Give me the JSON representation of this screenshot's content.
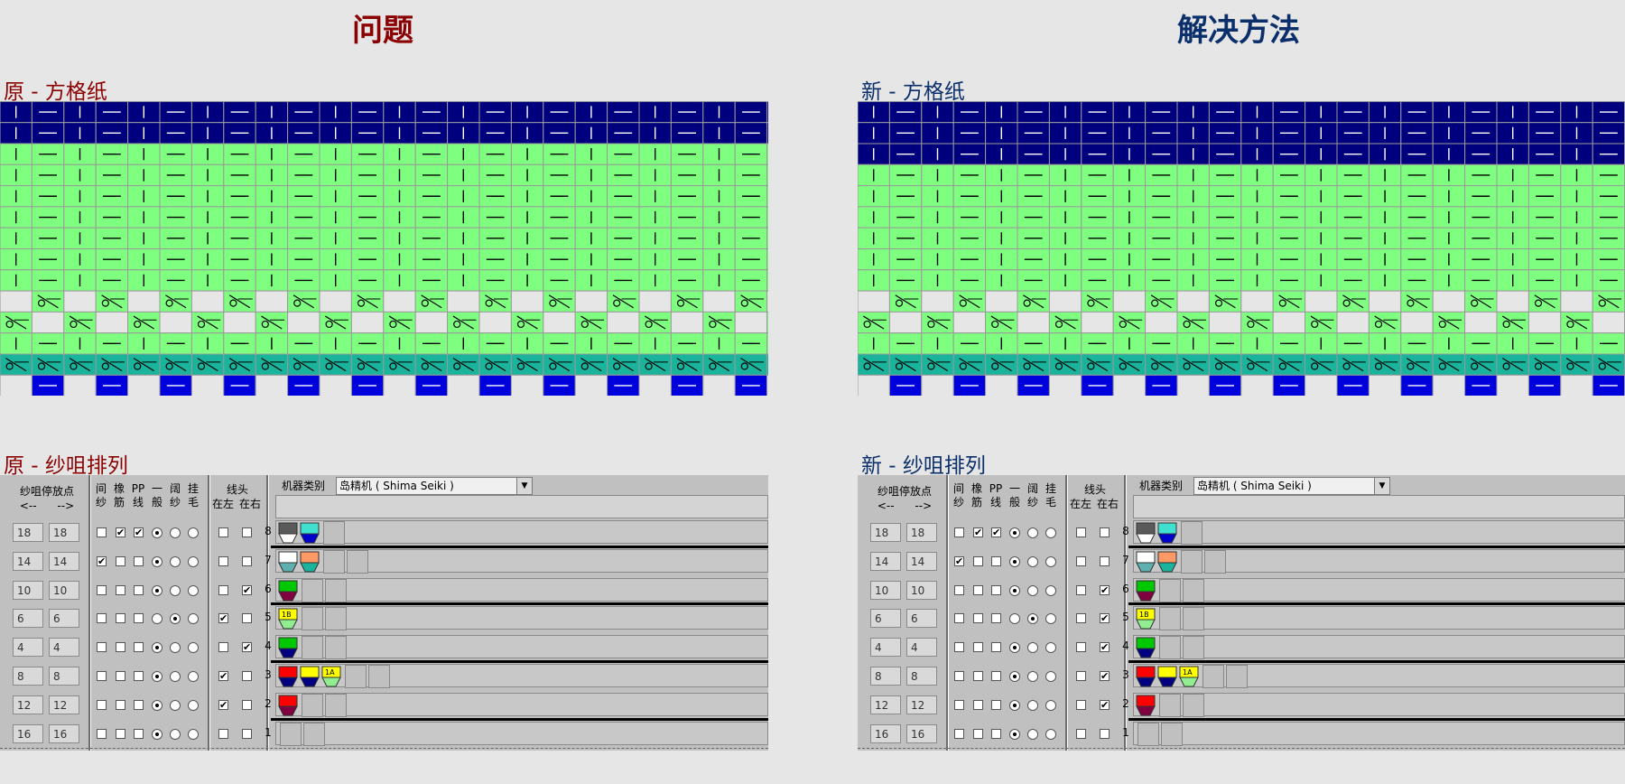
{
  "problem": {
    "heading": "问题",
    "grid_title": "原 - 方格纸",
    "yarn_title": "原 - 纱咀排列"
  },
  "solution": {
    "heading": "解决方法",
    "grid_title": "新 - 方格纸",
    "yarn_title": "新 - 纱咀排列"
  },
  "colors": {
    "problem_heading": "#8b0000",
    "solution_heading": "#0b2f6b",
    "grid_navy": "#00007f",
    "grid_green": "#7fff7f",
    "grid_teal": "#1ab39c",
    "grid_white": "#e6e6e6",
    "grid_blue": "#0000dd",
    "grid_line": "#9a9a9a",
    "panel_bg": "#c0c0c0"
  },
  "panel_labels": {
    "stop_point": "纱咀停放点",
    "arrows": "<--      -->",
    "col_jian": "间纱",
    "col_xiang": "橡筋",
    "col_pp": "PP线",
    "col_yi": "一般",
    "col_ge": "阔纱",
    "col_gua": "挂毛",
    "thread": "线头",
    "left": "在左",
    "right": "在右",
    "machine_label": "机器类别",
    "machine_value": "岛精机 ( Shima Seiki )"
  },
  "problem_rows": [
    {
      "n": "8",
      "a": "18",
      "b": "18",
      "cb": [
        false,
        true,
        true
      ],
      "radio": 0,
      "tl": false,
      "tr": false,
      "carriers": [
        {
          "top": "#5a5a5a",
          "bot": "#ffffff"
        },
        {
          "top": "#40e0d0",
          "bot": "#0000cd"
        }
      ],
      "slots": 1,
      "sep_below": true
    },
    {
      "n": "7",
      "a": "14",
      "b": "14",
      "cb": [
        true,
        false,
        false
      ],
      "radio": 0,
      "tl": false,
      "tr": false,
      "carriers": [
        {
          "top": "#ffffff",
          "bot": "#5fb0b0"
        },
        {
          "top": "#ff9a66",
          "bot": "#1ab39c"
        }
      ],
      "slots": 2,
      "sep_below": false
    },
    {
      "n": "6",
      "a": "10",
      "b": "10",
      "cb": [
        false,
        false,
        false
      ],
      "radio": 0,
      "tl": false,
      "tr": true,
      "carriers": [
        {
          "top": "#00c800",
          "bot": "#800040"
        }
      ],
      "slots": 2,
      "sep_below": true
    },
    {
      "n": "5",
      "a": "6",
      "b": "6",
      "cb": [
        false,
        false,
        false
      ],
      "radio": 1,
      "tl": true,
      "tr": false,
      "carriers": [
        {
          "top": "#ffff00",
          "bot": "#90ee90",
          "label": "1B"
        }
      ],
      "slots": 2,
      "sep_below": false
    },
    {
      "n": "4",
      "a": "4",
      "b": "4",
      "cb": [
        false,
        false,
        false
      ],
      "radio": 0,
      "tl": false,
      "tr": true,
      "carriers": [
        {
          "top": "#00c800",
          "bot": "#000080"
        }
      ],
      "slots": 2,
      "sep_below": true
    },
    {
      "n": "3",
      "a": "8",
      "b": "8",
      "cb": [
        false,
        false,
        false
      ],
      "radio": 0,
      "tl": true,
      "tr": false,
      "carriers": [
        {
          "top": "#ff0000",
          "bot": "#000080"
        },
        {
          "top": "#ffff00",
          "bot": "#000080"
        },
        {
          "top": "#ffff00",
          "bot": "#90ee90",
          "label": "1A"
        }
      ],
      "slots": 2,
      "sep_below": false
    },
    {
      "n": "2",
      "a": "12",
      "b": "12",
      "cb": [
        false,
        false,
        false
      ],
      "radio": 0,
      "tl": true,
      "tr": false,
      "carriers": [
        {
          "top": "#ff0000",
          "bot": "#800040"
        }
      ],
      "slots": 2,
      "sep_below": true
    },
    {
      "n": "1",
      "a": "16",
      "b": "16",
      "cb": [
        false,
        false,
        false
      ],
      "radio": 0,
      "tl": false,
      "tr": false,
      "carriers": [],
      "slots": 2,
      "sep_below": false
    }
  ],
  "solution_rows": [
    {
      "n": "8",
      "a": "18",
      "b": "18",
      "cb": [
        false,
        true,
        true
      ],
      "radio": 0,
      "tl": false,
      "tr": false,
      "carriers": [
        {
          "top": "#5a5a5a",
          "bot": "#ffffff"
        },
        {
          "top": "#40e0d0",
          "bot": "#0000cd"
        }
      ],
      "slots": 1,
      "sep_below": true
    },
    {
      "n": "7",
      "a": "14",
      "b": "14",
      "cb": [
        true,
        false,
        false
      ],
      "radio": 0,
      "tl": false,
      "tr": false,
      "carriers": [
        {
          "top": "#ffffff",
          "bot": "#5fb0b0"
        },
        {
          "top": "#ff9a66",
          "bot": "#1ab39c"
        }
      ],
      "slots": 2,
      "sep_below": false
    },
    {
      "n": "6",
      "a": "10",
      "b": "10",
      "cb": [
        false,
        false,
        false
      ],
      "radio": 0,
      "tl": false,
      "tr": true,
      "carriers": [
        {
          "top": "#00c800",
          "bot": "#800040"
        }
      ],
      "slots": 2,
      "sep_below": true
    },
    {
      "n": "5",
      "a": "6",
      "b": "6",
      "cb": [
        false,
        false,
        false
      ],
      "radio": 1,
      "tl": false,
      "tr": true,
      "carriers": [
        {
          "top": "#ffff00",
          "bot": "#90ee90",
          "label": "1B"
        }
      ],
      "slots": 2,
      "sep_below": false
    },
    {
      "n": "4",
      "a": "4",
      "b": "4",
      "cb": [
        false,
        false,
        false
      ],
      "radio": 0,
      "tl": false,
      "tr": true,
      "carriers": [
        {
          "top": "#00c800",
          "bot": "#000080"
        }
      ],
      "slots": 2,
      "sep_below": true
    },
    {
      "n": "3",
      "a": "8",
      "b": "8",
      "cb": [
        false,
        false,
        false
      ],
      "radio": 0,
      "tl": false,
      "tr": true,
      "carriers": [
        {
          "top": "#ff0000",
          "bot": "#000080"
        },
        {
          "top": "#ffff00",
          "bot": "#000080"
        },
        {
          "top": "#ffff00",
          "bot": "#90ee90",
          "label": "1A"
        }
      ],
      "slots": 2,
      "sep_below": false
    },
    {
      "n": "2",
      "a": "12",
      "b": "12",
      "cb": [
        false,
        false,
        false
      ],
      "radio": 0,
      "tl": false,
      "tr": true,
      "carriers": [
        {
          "top": "#ff0000",
          "bot": "#800040"
        }
      ],
      "slots": 2,
      "sep_below": true
    },
    {
      "n": "1",
      "a": "16",
      "b": "16",
      "cb": [
        false,
        false,
        false
      ],
      "radio": 0,
      "tl": false,
      "tr": false,
      "carriers": [],
      "slots": 2,
      "sep_below": false
    }
  ],
  "problem_grid_rows": [
    "navy",
    "navy",
    "green",
    "green",
    "green",
    "green",
    "green",
    "green",
    "green",
    "tuck-a",
    "tuck-b",
    "green",
    "teal",
    "base"
  ],
  "solution_grid_rows": [
    "navy",
    "navy",
    "navy",
    "green",
    "green",
    "green",
    "green",
    "green",
    "green",
    "tuck-a",
    "tuck-b",
    "green",
    "teal",
    "base"
  ]
}
